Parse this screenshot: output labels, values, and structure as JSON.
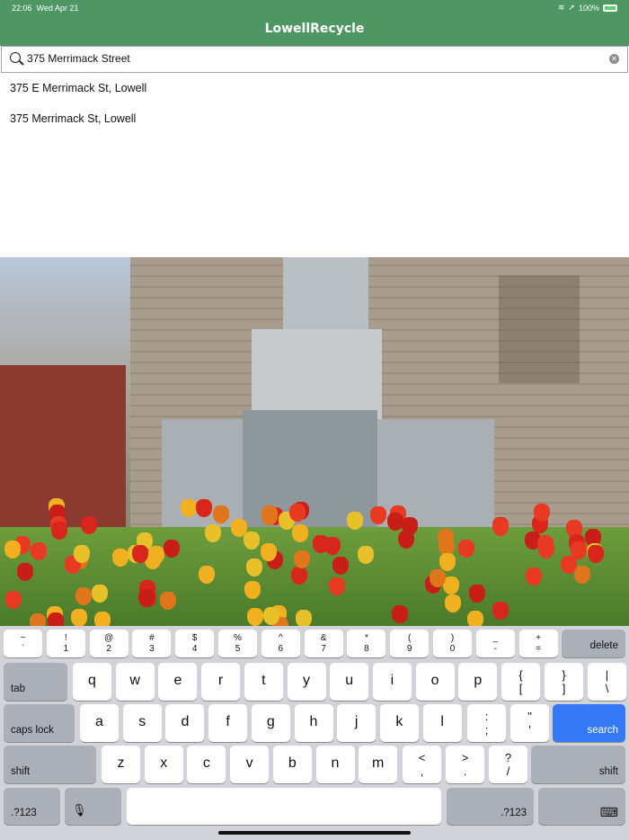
{
  "status": {
    "time": "22:06",
    "date": "Wed Apr 21",
    "battery": "100%"
  },
  "nav": {
    "title": "LowellRecycle"
  },
  "search": {
    "value": "375 Merrimack Street",
    "icon": "search-location-icon",
    "clear_icon": "clear-icon"
  },
  "suggestions": [
    "375 E Merrimack St, Lowell",
    "375 Merrimack St, Lowell"
  ],
  "photo": {
    "subject": "monument with tulips"
  },
  "keyboard": {
    "row1": [
      [
        "~",
        "`"
      ],
      [
        "!",
        "1"
      ],
      [
        "@",
        "2"
      ],
      [
        "#",
        "3"
      ],
      [
        "$",
        "4"
      ],
      [
        "%",
        "5"
      ],
      [
        "^",
        "6"
      ],
      [
        "&",
        "7"
      ],
      [
        "*",
        "8"
      ],
      [
        "(",
        "9"
      ],
      [
        ")",
        "0"
      ],
      [
        "_",
        "-"
      ],
      [
        "+",
        "="
      ]
    ],
    "delete": "delete",
    "tab": "tab",
    "row2": [
      "q",
      "w",
      "e",
      "r",
      "t",
      "y",
      "u",
      "i",
      "o",
      "p"
    ],
    "row2_sym": [
      [
        "{",
        "["
      ],
      [
        "}",
        "]"
      ],
      [
        "|",
        "\\"
      ]
    ],
    "caps": "caps lock",
    "row3": [
      "a",
      "s",
      "d",
      "f",
      "g",
      "h",
      "j",
      "k",
      "l"
    ],
    "row3_sym": [
      [
        ":",
        ";"
      ],
      [
        "\"",
        "'"
      ]
    ],
    "search": "search",
    "shift": "shift",
    "row4": [
      "z",
      "x",
      "c",
      "v",
      "b",
      "n",
      "m"
    ],
    "row4_sym": [
      [
        "<",
        ","
      ],
      [
        ">",
        "."
      ],
      [
        "?",
        "/"
      ]
    ],
    "numbers": ".?123",
    "search_color": "#3478f6"
  }
}
